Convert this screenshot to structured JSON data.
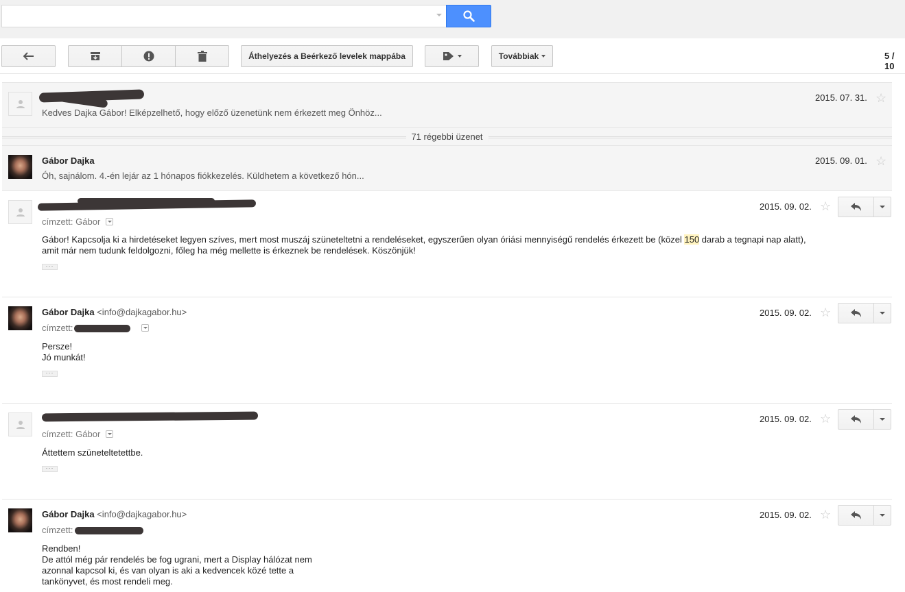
{
  "search": {
    "placeholder": "",
    "value": ""
  },
  "toolbar": {
    "move_to_inbox_label": "Áthelyezés a Beérkező levelek mappába",
    "more_label": "Továbbiak",
    "pager": "5 / 10"
  },
  "older_messages": {
    "label": "71 régebbi üzenet"
  },
  "messages": [
    {
      "sender": "",
      "snippet": "Kedves Dajka Gábor! Elképzelhető, hogy előző üzenetünk nem érkezett meg Önhöz...",
      "date": "2015. 07. 31."
    },
    {
      "sender": "Gábor Dajka",
      "snippet": "Óh, sajnálom. 4.-én lejár az 1 hónapos fiókkezelés. Küldhetem a következő hón...",
      "date": "2015. 09. 01."
    },
    {
      "sender": "",
      "to_prefix": "címzett:",
      "to_name": "Gábor",
      "date": "2015. 09. 02.",
      "body_pre": "Gábor! Kapcsolja ki a hirdetéseket legyen szíves, mert most muszáj szüneteltetni a rendeléseket, egyszerűen olyan óriási mennyiségű rendelés érkezett be (közel ",
      "body_hl": "150",
      "body_post": " darab a tegnapi nap alatt),",
      "body_line2": "amit már nem tudunk feldolgozni, főleg ha még mellette is érkeznek be rendelések. Köszönjük!"
    },
    {
      "sender": "Gábor Dajka",
      "sender_email": "<info@dajkagabor.hu>",
      "to_prefix": "címzett:",
      "date": "2015. 09. 02.",
      "body_line1": "Persze!",
      "body_line2": "Jó munkát!"
    },
    {
      "sender": "",
      "to_prefix": "címzett:",
      "to_name": "Gábor",
      "date": "2015. 09. 02.",
      "body_line1": "Áttettem szüneteltetettbe."
    },
    {
      "sender": "Gábor Dajka",
      "sender_email": "<info@dajkagabor.hu>",
      "to_prefix": "címzett:",
      "date": "2015. 09. 02.",
      "body_line1": "Rendben!",
      "body_line2": "De attól még pár rendelés be fog ugrani, mert a Display hálózat nem",
      "body_line3": "azonnal kapcsol ki, és van olyan is aki a kedvencek közé tette a",
      "body_line4": "tankönyvet, és most rendeli meg."
    }
  ],
  "icons": {
    "search": "search-icon",
    "back": "back-arrow-icon",
    "archive": "archive-icon",
    "spam": "report-spam-icon",
    "delete": "trash-icon",
    "labels": "label-tag-icon",
    "star": "star-icon",
    "reply": "reply-icon"
  },
  "colors": {
    "search_button": "#4d90fe",
    "highlight": "#fff3bf"
  }
}
